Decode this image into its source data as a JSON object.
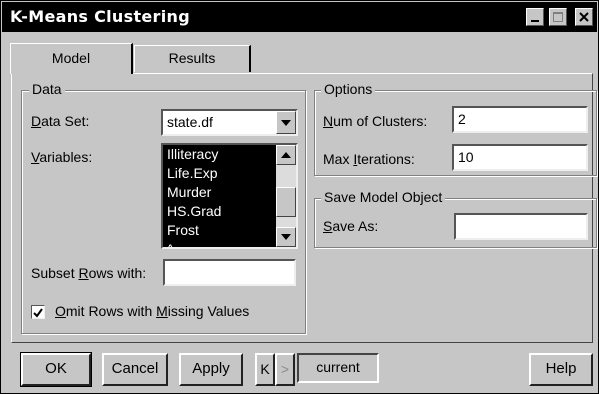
{
  "window": {
    "title": "K-Means Clustering"
  },
  "tabs": [
    {
      "label": "Model",
      "selected": true
    },
    {
      "label": "Results",
      "selected": false
    }
  ],
  "data_group": {
    "legend": "Data",
    "dataset_label_u": "D",
    "dataset_label_rest": "ata Set:",
    "dataset_value": "state.df",
    "variables_label_u": "V",
    "variables_label_rest": "ariables:",
    "variables": [
      "Illiteracy",
      "Life.Exp",
      "Murder",
      "HS.Grad",
      "Frost",
      "^"
    ],
    "subset_label_pre": "Subset ",
    "subset_label_u": "R",
    "subset_label_post": "ows with:",
    "subset_value": "",
    "omit_checked": true,
    "omit_label_pre": "",
    "omit_label_u": "O",
    "omit_label_post": "mit Rows with ",
    "omit_label_u2": "M",
    "omit_label_post2": "issing Values"
  },
  "options_group": {
    "legend": "Options",
    "num_label_u": "N",
    "num_label_rest": "um of Clusters:",
    "num_value": "2",
    "maxit_label_pre": "Max ",
    "maxit_label_u": "I",
    "maxit_label_post": "terations:",
    "maxit_value": "10"
  },
  "save_group": {
    "legend": "Save Model Object",
    "save_label_u": "S",
    "save_label_rest": "ave As:",
    "save_value": ""
  },
  "footer": {
    "ok": "OK",
    "cancel": "Cancel",
    "apply": "Apply",
    "prev": "K",
    "next": ">",
    "current": "current",
    "help": "Help"
  }
}
